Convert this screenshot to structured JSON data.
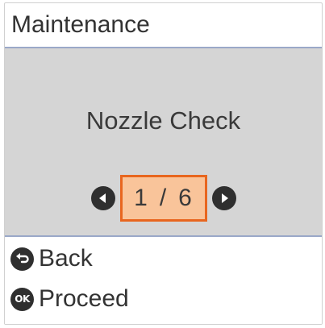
{
  "header": {
    "title": "Maintenance"
  },
  "main": {
    "item_title": "Nozzle Check",
    "pager": {
      "current": "1",
      "separator": "/",
      "total": "6",
      "prev_icon": "arrow-left-icon",
      "next_icon": "arrow-right-icon"
    }
  },
  "footer": {
    "back_label": "Back",
    "back_icon": "back-icon",
    "proceed_label": "Proceed",
    "proceed_icon_text": "OK"
  },
  "colors": {
    "divider": "#9aa8c8",
    "content_bg": "#d5d5d5",
    "highlight_border": "#e8661f",
    "highlight_fill": "#f9c49a"
  }
}
